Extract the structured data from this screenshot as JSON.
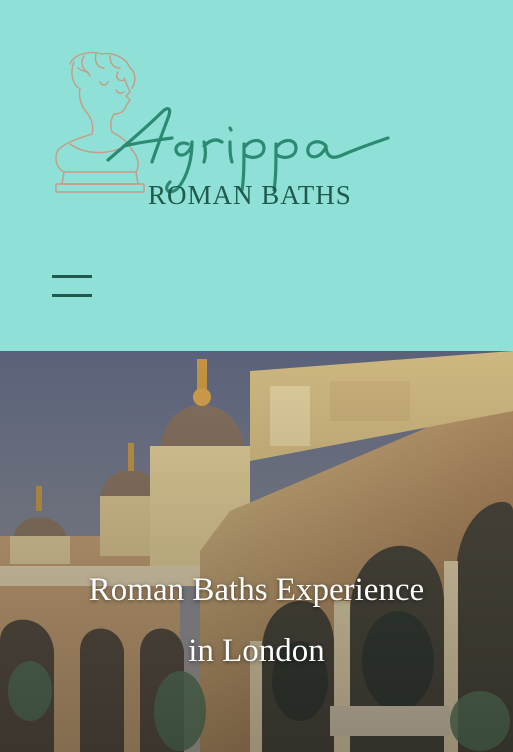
{
  "header": {
    "background": "#8fe0d6",
    "logo": {
      "script_text": "Agrippa",
      "subtitle": "ROMAN BATHS",
      "script_color": "#2a8a72",
      "subtitle_color": "#1f5a4d",
      "bust_color": "#c99a84",
      "icon": "roman-bust-icon"
    },
    "menu": {
      "icon": "hamburger-icon",
      "color": "#1f5a4d"
    }
  },
  "hero": {
    "title_line1": "Roman Baths Experience",
    "title_line2": "in London",
    "text_color": "#ffffff"
  }
}
